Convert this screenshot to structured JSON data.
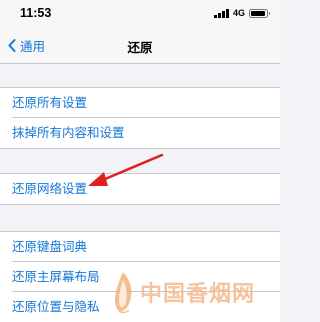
{
  "status_bar": {
    "time": "11:53",
    "network": "4G",
    "battery_level": 0.9
  },
  "nav": {
    "back_label": "通用",
    "title": "还原"
  },
  "groups": [
    {
      "items": [
        "还原所有设置",
        "抹掉所有内容和设置"
      ]
    },
    {
      "items": [
        "还原网络设置"
      ]
    },
    {
      "items": [
        "还原键盘词典",
        "还原主屏幕布局",
        "还原位置与隐私"
      ]
    }
  ],
  "annotation": {
    "arrow_color": "#e02020",
    "points_to": "还原网络设置"
  },
  "watermark": {
    "text": "中国香烟网",
    "color": "#f4b98c",
    "logo": "flame-leaf-logo"
  },
  "colors": {
    "accent": "#1477d6",
    "background": "#f2f2f7"
  }
}
